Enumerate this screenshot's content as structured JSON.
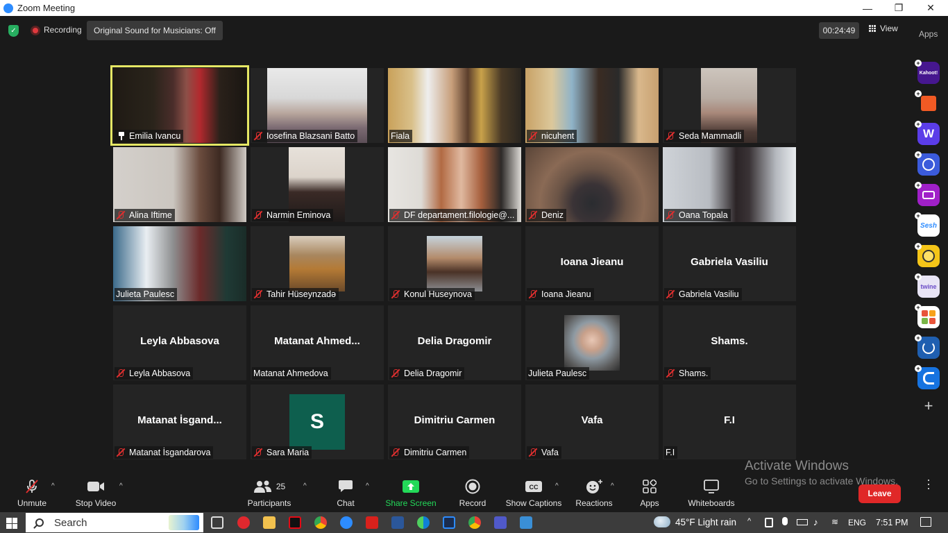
{
  "window": {
    "title": "Zoom Meeting",
    "controls": {
      "minimize": "—",
      "maximize": "❐",
      "close": "✕"
    }
  },
  "topbar": {
    "recording_label": "Recording",
    "sound_button": "Original Sound for Musicians: Off",
    "timer": "00:24:49",
    "view_label": "View",
    "apps_label": "Apps"
  },
  "tiles": [
    {
      "label": "Emilia Ivancu",
      "pinned": true,
      "muted": false,
      "video": true,
      "active": true
    },
    {
      "label": "Iosefina Blazsani Batto",
      "muted": true,
      "video": true
    },
    {
      "label": "Fiala",
      "muted": false,
      "video": true
    },
    {
      "label": "nicuhent",
      "muted": true,
      "video": true
    },
    {
      "label": "Seda Mammadli",
      "muted": true,
      "video": true
    },
    {
      "label": "Alina Iftime",
      "muted": true,
      "video": true
    },
    {
      "label": "Narmin Eminova",
      "muted": true,
      "video": true
    },
    {
      "label": "DF departament.filologie@...",
      "muted": true,
      "video": true
    },
    {
      "label": "Deniz",
      "muted": true,
      "video": true
    },
    {
      "label": "Oana Topala",
      "muted": true,
      "video": true
    },
    {
      "label": "Julieta Paulesc",
      "muted": false,
      "video": true
    },
    {
      "label": "Tahir Hüseynzadə",
      "muted": true,
      "video": true
    },
    {
      "label": "Konul Huseynova",
      "muted": true,
      "video": true
    },
    {
      "label": "Ioana Jieanu",
      "display_name": "Ioana Jieanu",
      "muted": true,
      "video": false
    },
    {
      "label": "Gabriela Vasiliu",
      "display_name": "Gabriela Vasiliu",
      "muted": true,
      "video": false
    },
    {
      "label": "Leyla Abbasova",
      "display_name": "Leyla Abbasova",
      "muted": true,
      "video": false
    },
    {
      "label": "Matanat Ahmedova",
      "display_name": "Matanat  Ahmed...",
      "muted": false,
      "video": false
    },
    {
      "label": "Delia Dragomir",
      "display_name": "Delia Dragomir",
      "muted": true,
      "video": false
    },
    {
      "label": "Julieta Paulesc",
      "muted": false,
      "video": true
    },
    {
      "label": "Shams.",
      "display_name": "Shams.",
      "muted": true,
      "video": false
    },
    {
      "label": "Matanat İsgandarova",
      "display_name": "Matanat  İsgand...",
      "muted": true,
      "video": false
    },
    {
      "label": "Sara Maria",
      "avatar_letter": "S",
      "muted": true,
      "video": false
    },
    {
      "label": "Dimitriu Carmen",
      "display_name": "Dimitriu Carmen",
      "muted": false,
      "video": false
    },
    {
      "label": "Vafa",
      "display_name": "Vafa",
      "muted": true,
      "video": false
    },
    {
      "label": "F.I",
      "display_name": "F.I",
      "muted": false,
      "video": false
    }
  ],
  "app_rail": [
    {
      "name": "Kahoot!",
      "color": "#46178f"
    },
    {
      "name": "",
      "color": "#f15a24"
    },
    {
      "name": "W",
      "color": "#5b3de8"
    },
    {
      "name": "",
      "color": "#3b5bdb"
    },
    {
      "name": "",
      "color": "#a020c8"
    },
    {
      "name": "Sesh",
      "color": "#ffffff"
    },
    {
      "name": "",
      "color": "#f5c518"
    },
    {
      "name": "twine",
      "color": "#e8e4f5"
    },
    {
      "name": "",
      "color": "#ffffff"
    },
    {
      "name": "",
      "color": "#1f5fb0"
    },
    {
      "name": "",
      "color": "#1673e0"
    }
  ],
  "watermark": {
    "line1": "Activate Windows",
    "line2": "Go to Settings to activate Windows."
  },
  "toolbar": {
    "unmute": "Unmute",
    "stop_video": "Stop Video",
    "participants": "Participants",
    "participants_count": "25",
    "chat": "Chat",
    "share_screen": "Share Screen",
    "record": "Record",
    "show_captions": "Show Captions",
    "reactions": "Reactions",
    "apps": "Apps",
    "whiteboards": "Whiteboards",
    "leave": "Leave",
    "share_color": "#23d959"
  },
  "taskbar": {
    "search_placeholder": "Search",
    "weather": "45°F  Light rain",
    "language": "ENG",
    "time": "7:51 PM"
  }
}
